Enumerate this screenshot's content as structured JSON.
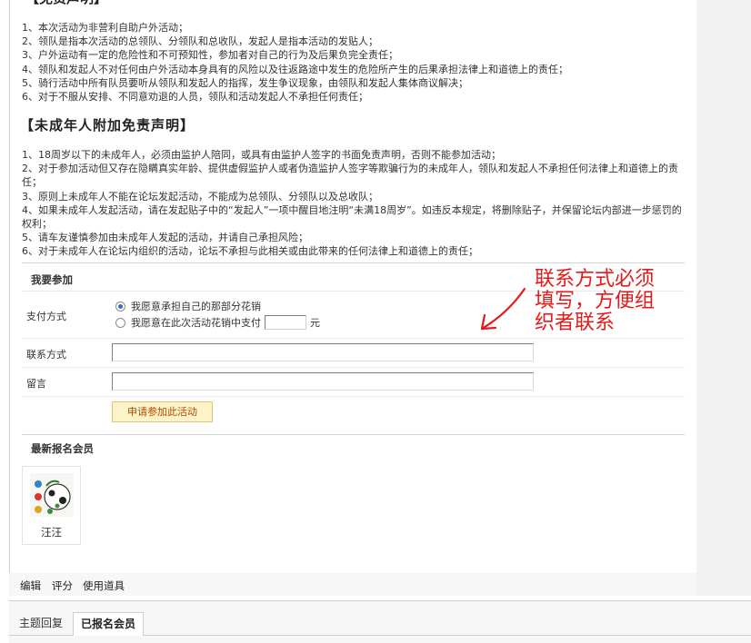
{
  "disclaimer": {
    "top_heading": "【免责声明】",
    "items": [
      "1、本次活动为非营利自助户外活动；",
      "2、领队是指本次活动的总领队、分领队和总收队，发起人是指本活动的发贴人；",
      "3、户外运动有一定的危险性和不可预知性，参加者对自己的行为及后果负完全责任；",
      "4、领队和发起人不对任何由户外活动本身具有的风险以及往返路途中发生的危险所产生的后果承担法律上和道德上的责任；",
      "5、骑行活动中所有队员要听从领队和发起人的指挥，发生争议现象，由领队和发起人集体商议解决；",
      "6、对于不服从安排、不同意劝退的人员，领队和活动发起人不承担任何责任；"
    ]
  },
  "minor_disclaimer": {
    "heading": "【未成年人附加免责声明】",
    "items": [
      "1、18周岁以下的未成年人，必须由监护人陪同，或具有由监护人签字的书面免责声明，否则不能参加活动；",
      "2、对于参加活动但又存在隐瞒真实年龄、提供虚假监护人或者伪造监护人签字等欺骗行为的未成年人，领队和发起人不承担任何法律上和道德上的责任；",
      "3、原则上未成年人不能在论坛发起活动，不能成为总领队、分领队以及总收队；",
      "4、如果未成年人发起活动，请在发起贴子中的“发起人”一项中醒目地注明“未满18周岁”。如违反本规定，将删除贴子，并保留论坛内部进一步惩罚的权利；",
      "5、请车友谨慎参加由未成年人发起的活动，并请自己承担风险；",
      "6、对于未成年人在论坛内组织的活动，论坛不承担与此相关或由此带来的任何法律上和道德上的责任；"
    ]
  },
  "join_form": {
    "title": "我要参加",
    "payment_label": "支付方式",
    "payment_options": [
      {
        "label": "我愿意承担自己的那部分花销",
        "checked": true
      },
      {
        "label": "我愿意在此次活动花销中支付",
        "checked": false
      }
    ],
    "amount_value": "",
    "amount_unit": "元",
    "contact_label": "联系方式",
    "contact_value": "",
    "message_label": "留言",
    "message_value": "",
    "submit_label": "申请参加此活动"
  },
  "new_members": {
    "title": "最新报名会员",
    "members": [
      {
        "name": "汪汪"
      }
    ]
  },
  "annotation": {
    "text": "联系方式必须填写，方便组织者联系",
    "color": "#e31b1b"
  },
  "actions": [
    "编辑",
    "评分",
    "使用道具"
  ],
  "tabs": [
    {
      "label": "主题回复",
      "active": false
    },
    {
      "label": "已报名会员",
      "active": true
    }
  ]
}
